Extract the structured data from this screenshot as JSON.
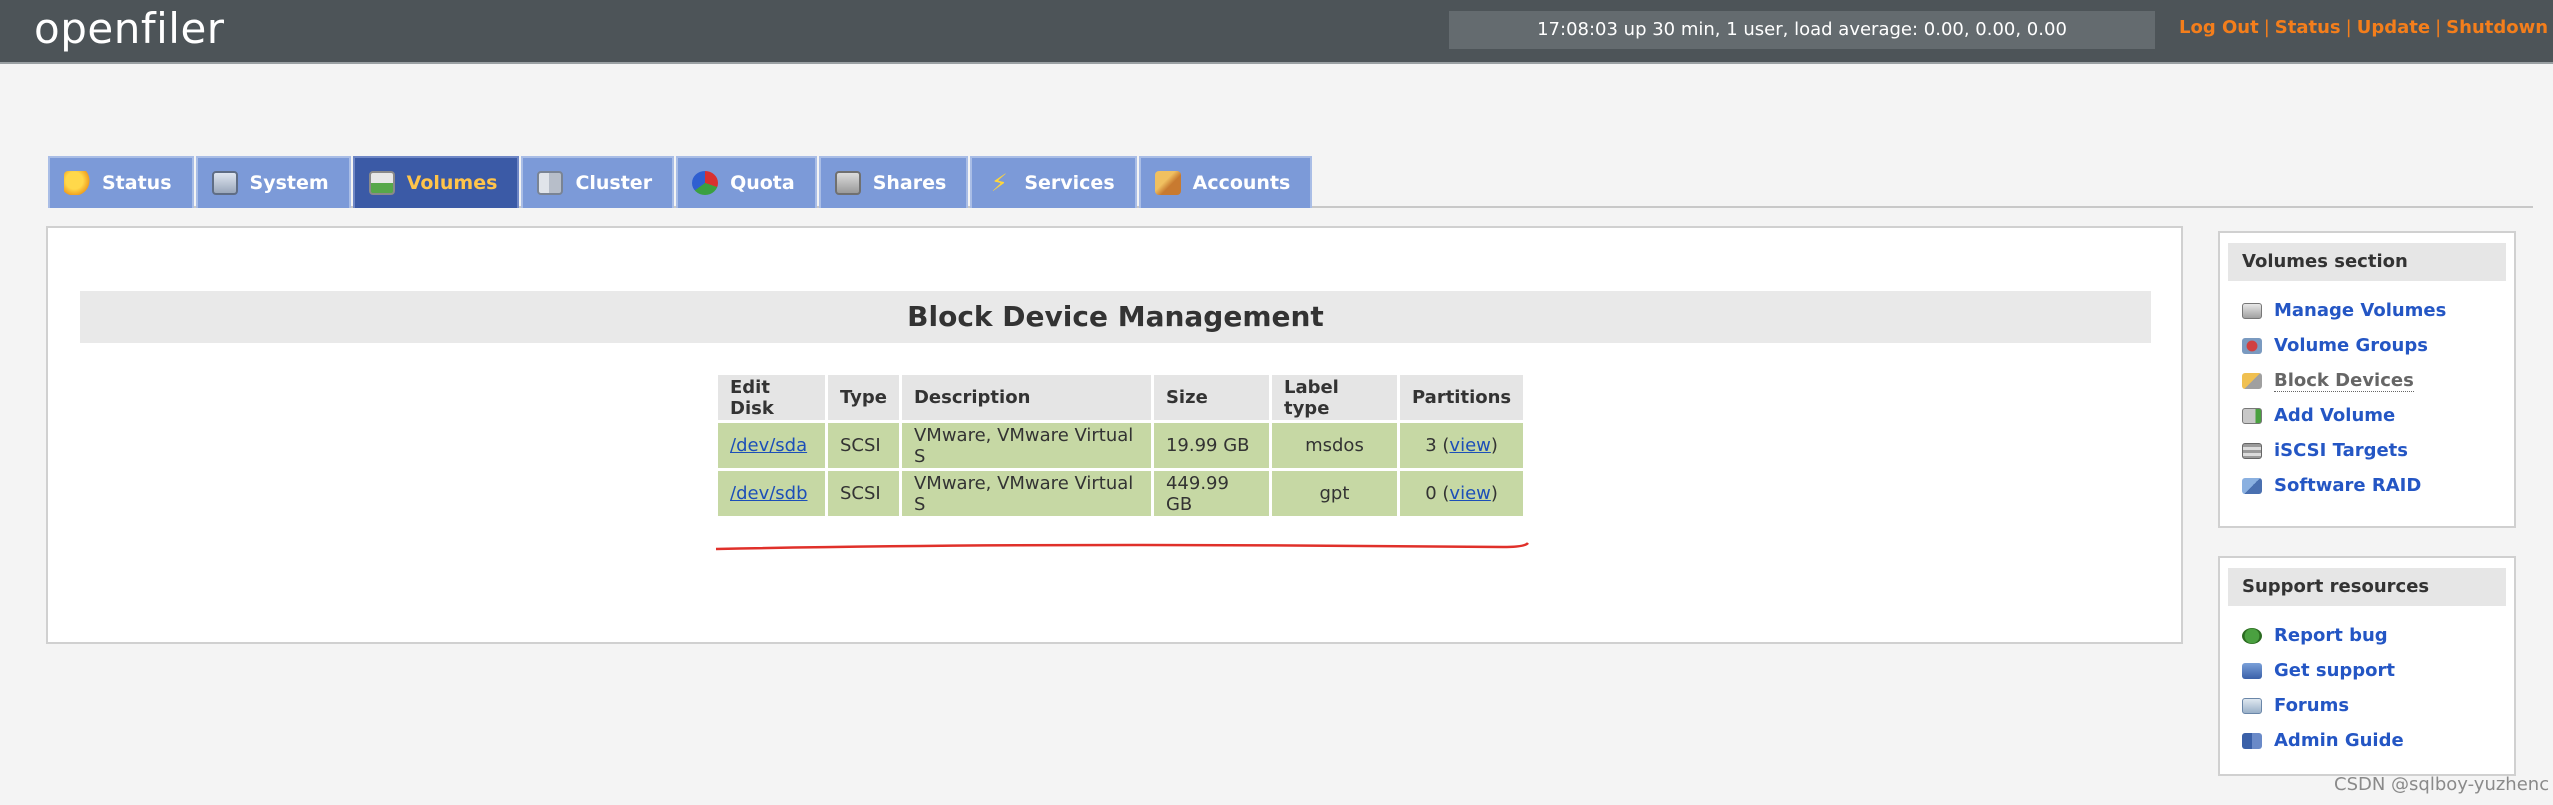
{
  "header": {
    "logo": "openfiler",
    "uptime": "17:08:03 up 30 min, 1 user, load average: 0.00, 0.00, 0.00",
    "links": [
      "Log Out",
      "Status",
      "Update",
      "Shutdown"
    ]
  },
  "tabs": [
    {
      "label": "Status",
      "icon": "status-icon"
    },
    {
      "label": "System",
      "icon": "system-icon"
    },
    {
      "label": "Volumes",
      "icon": "volumes-icon",
      "active": true
    },
    {
      "label": "Cluster",
      "icon": "cluster-icon"
    },
    {
      "label": "Quota",
      "icon": "quota-icon"
    },
    {
      "label": "Shares",
      "icon": "shares-icon"
    },
    {
      "label": "Services",
      "icon": "services-icon"
    },
    {
      "label": "Accounts",
      "icon": "accounts-icon"
    }
  ],
  "main": {
    "title": "Block Device Management",
    "table": {
      "headers": [
        "Edit Disk",
        "Type",
        "Description",
        "Size",
        "Label type",
        "Partitions"
      ],
      "rows": [
        {
          "disk": "/dev/sda",
          "type": "SCSI",
          "description": "VMware, VMware Virtual S",
          "size": "19.99 GB",
          "label_type": "msdos",
          "partitions": "3",
          "view": "view"
        },
        {
          "disk": "/dev/sdb",
          "type": "SCSI",
          "description": "VMware, VMware Virtual S",
          "size": "449.99 GB",
          "label_type": "gpt",
          "partitions": "0",
          "view": "view"
        }
      ]
    }
  },
  "sidebar": {
    "volumes_section": {
      "title": "Volumes section",
      "items": [
        {
          "label": "Manage Volumes",
          "icon": "manage-volumes-icon"
        },
        {
          "label": "Volume Groups",
          "icon": "volume-groups-icon"
        },
        {
          "label": "Block Devices",
          "icon": "block-devices-icon",
          "current": true
        },
        {
          "label": "Add Volume",
          "icon": "add-volume-icon"
        },
        {
          "label": "iSCSI Targets",
          "icon": "iscsi-targets-icon"
        },
        {
          "label": "Software RAID",
          "icon": "software-raid-icon"
        }
      ]
    },
    "support": {
      "title": "Support resources",
      "items": [
        {
          "label": "Report bug",
          "icon": "report-bug-icon"
        },
        {
          "label": "Get support",
          "icon": "get-support-icon"
        },
        {
          "label": "Forums",
          "icon": "forums-icon"
        },
        {
          "label": "Admin Guide",
          "icon": "admin-guide-icon"
        }
      ]
    }
  },
  "watermark": "CSDN @sqlboy-yuzhenc",
  "colors": {
    "header_bg": "#4d5458",
    "link_orange": "#f47e1b",
    "tab_bg": "#7c9ad8",
    "tab_active_bg": "#3b5aa6",
    "tab_active_text": "#ffc44a",
    "row_green": "#c6d8a4",
    "annotation_red": "#e0302a"
  }
}
